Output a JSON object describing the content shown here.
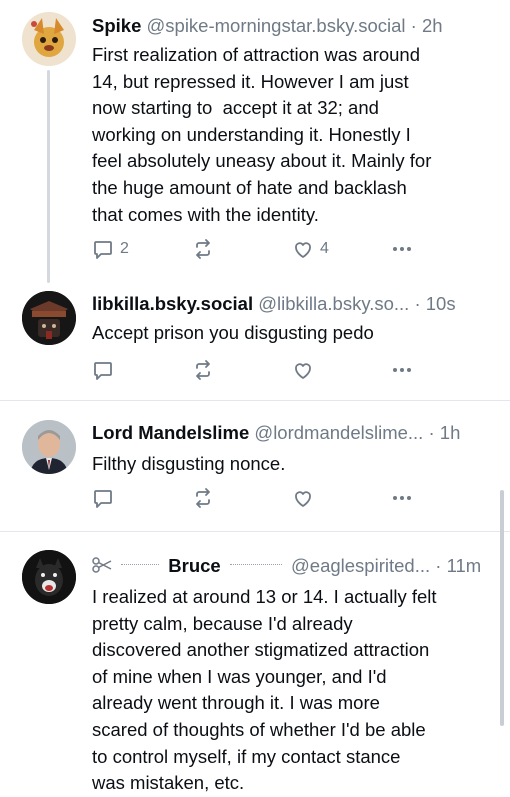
{
  "posts": [
    {
      "name": "Spike",
      "handle": "@spike-morningstar.bsky.social",
      "separator": "·",
      "time": "2h",
      "lines": [
        "First realization of attraction was around",
        "14, but repressed it. However I am just",
        "now starting to  accept it at 32; and",
        "working on understanding it. Honestly I",
        "feel absolutely uneasy about it. Mainly for",
        "the huge amount of hate and backlash",
        "that comes with the identity."
      ],
      "reply_count": "2",
      "like_count": "4"
    },
    {
      "name": "libkilla.bsky.social",
      "handle": "@libkilla.bsky.so...",
      "separator": "·",
      "time": "10s",
      "lines": [
        "Accept prison you disgusting pedo"
      ]
    },
    {
      "name": "Lord Mandelslime",
      "handle": "@lordmandelslime...",
      "separator": "·",
      "time": "1h",
      "lines": [
        "Filthy disgusting nonce."
      ]
    },
    {
      "name": "Bruce",
      "handle": "@eaglespirited...",
      "separator": "·",
      "time": "11m",
      "lines": [
        "I realized at around 13 or 14. I actually felt",
        "pretty calm, because I'd already",
        "discovered another stigmatized attraction",
        "of mine when I was younger, and I'd",
        "already went through it. I was more",
        "scared of thoughts of whether I'd be able",
        "to control myself, if my contact stance",
        "was mistaken, etc."
      ]
    }
  ],
  "icons": {
    "reply": "speech-bubble-icon",
    "repost": "repost-arrows-icon",
    "like": "heart-icon",
    "more": "ellipsis-icon",
    "scissors": "scissors-icon"
  },
  "colors": {
    "text": "#0b0f14",
    "muted": "#6f7a86",
    "divider": "#e3e6ea",
    "thread_line": "#d4d9df"
  }
}
